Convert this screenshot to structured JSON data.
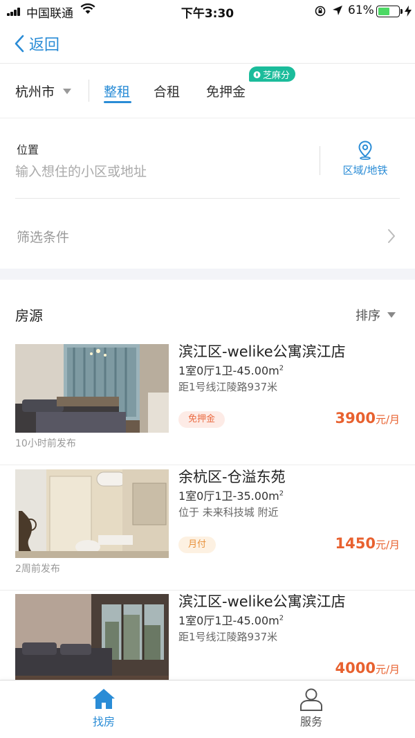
{
  "status_bar": {
    "carrier": "中国联通",
    "time": "下午3:30",
    "battery_percent": "61%",
    "battery_level": 0.61
  },
  "nav": {
    "back_label": "返回"
  },
  "filters": {
    "city": "杭州市",
    "tabs": [
      {
        "label": "整租",
        "active": true
      },
      {
        "label": "合租",
        "active": false
      },
      {
        "label": "免押金",
        "active": false
      }
    ],
    "sesame_badge": "芝麻分"
  },
  "location": {
    "label": "位置",
    "placeholder": "输入想住的小区或地址",
    "area_button": "区域/地铁"
  },
  "filter_conditions": {
    "label": "筛选条件"
  },
  "listings_header": {
    "title": "房源",
    "sort_label": "排序"
  },
  "listings": [
    {
      "title": "滨江区-welike公寓滨江店",
      "spec": "1室0厅1卫-45.00m",
      "spec_sup": "2",
      "distance": "距1号线江陵路937米",
      "tag": "免押金",
      "price": "3900",
      "price_unit": "元/月",
      "posted": "10小时前发布"
    },
    {
      "title": "余杭区-仓溢东苑",
      "spec": "1室0厅1卫-35.00m",
      "spec_sup": "2",
      "distance": "位于 未来科技城 附近",
      "tag": "月付",
      "price": "1450",
      "price_unit": "元/月",
      "posted": "2周前发布"
    },
    {
      "title": "滨江区-welike公寓滨江店",
      "spec": "1室0厅1卫-45.00m",
      "spec_sup": "2",
      "distance": "距1号线江陵路937米",
      "price": "4000",
      "price_unit": "元/月"
    }
  ],
  "tab_bar": {
    "items": [
      {
        "label": "找房",
        "icon": "house-icon",
        "active": true
      },
      {
        "label": "服务",
        "icon": "person-icon",
        "active": false
      }
    ]
  },
  "colors": {
    "accent": "#2a8cd6",
    "price": "#e8612f",
    "sesame": "#1bbc9b"
  }
}
